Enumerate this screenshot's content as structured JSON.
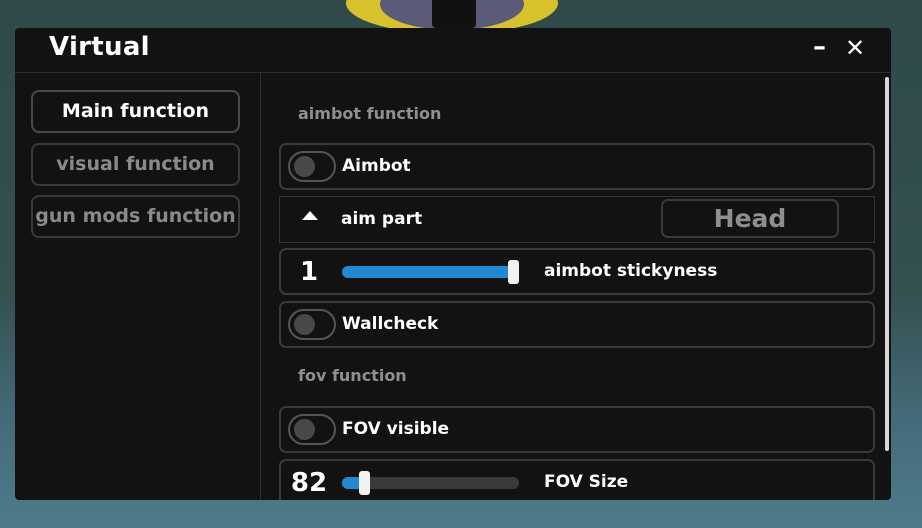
{
  "window": {
    "title": "Virtual",
    "minimize_label": "–",
    "close_label": "✕"
  },
  "sidebar": {
    "items": [
      {
        "label": "Main function",
        "active": true
      },
      {
        "label": "visual function",
        "active": false
      },
      {
        "label": "gun mods function",
        "active": false
      }
    ]
  },
  "sections": {
    "aimbot": "aimbot function",
    "fov": "fov function"
  },
  "controls": {
    "aimbot": {
      "label": "Aimbot",
      "enabled": false
    },
    "aim_part": {
      "label": "aim part",
      "value": "Head",
      "icon": "caret-up-icon"
    },
    "stickyness": {
      "label": "aimbot stickyness",
      "value": "1",
      "fill_fraction": 1.0
    },
    "wallcheck": {
      "label": "Wallcheck",
      "enabled": false
    },
    "fov_visible": {
      "label": "FOV visible",
      "enabled": false
    },
    "fov_size": {
      "label": "FOV Size",
      "value": "82",
      "fill_fraction": 0.16
    }
  },
  "colors": {
    "accent": "#1f8ad1",
    "window_bg": "#121212",
    "border": "#3a3a3a"
  }
}
